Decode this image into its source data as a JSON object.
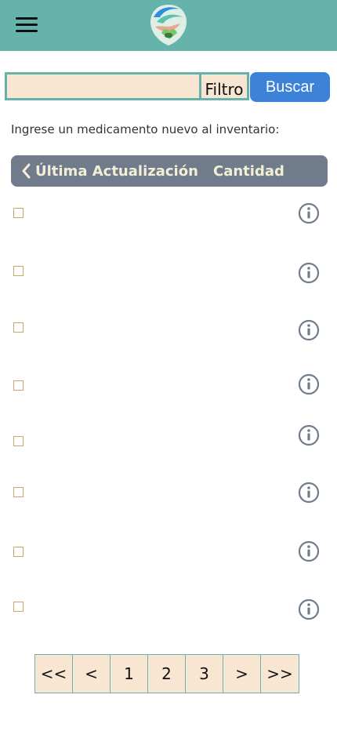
{
  "header": {
    "menu_icon": "hamburger-menu-icon",
    "logo_icon": "hands-heart-logo-icon"
  },
  "search": {
    "value": "",
    "placeholder": "",
    "filter_label": "Filtro",
    "button_label": "Buscar"
  },
  "instruction": "Ingrese un medicamento nuevo al inventario:",
  "table": {
    "back_icon": "chevron-left-icon",
    "col1": "Última Actualización",
    "col2": "Cantidad",
    "rows": [
      {
        "checked": false,
        "icon": "info-icon"
      },
      {
        "checked": false,
        "icon": "info-icon"
      },
      {
        "checked": false,
        "icon": "info-icon"
      },
      {
        "checked": false,
        "icon": "info-icon"
      },
      {
        "checked": false,
        "icon": "info-icon"
      },
      {
        "checked": false,
        "icon": "info-icon"
      },
      {
        "checked": false,
        "icon": "info-icon"
      },
      {
        "checked": false,
        "icon": "info-icon"
      }
    ]
  },
  "pagination": {
    "first": "<<",
    "prev": "<",
    "pages": [
      "1",
      "2",
      "3"
    ],
    "next": ">",
    "last": ">>"
  },
  "colors": {
    "header": "#66b3ab",
    "input_bg": "#f8e6d2",
    "button": "#3b82d8",
    "table_header": "#707c8c",
    "table_header_text": "#f3efd6"
  }
}
